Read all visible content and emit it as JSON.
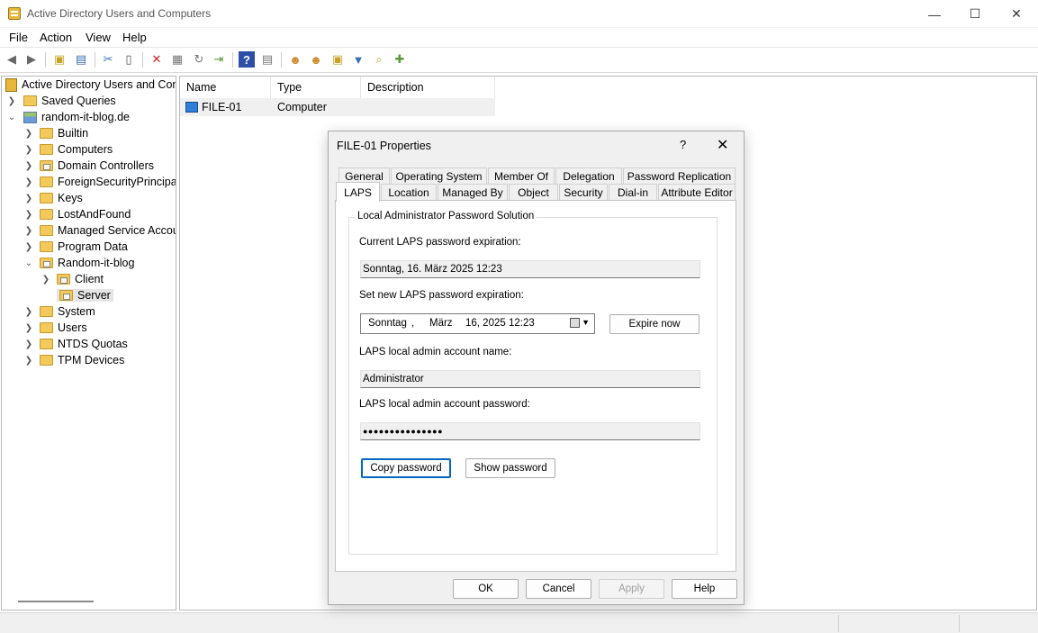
{
  "window": {
    "title": "Active Directory Users and Computers"
  },
  "menu": [
    "File",
    "Action",
    "View",
    "Help"
  ],
  "tree": {
    "root": "Active Directory Users and Com",
    "saved_queries": "Saved Queries",
    "domain": "random-it-blog.de",
    "items": [
      "Builtin",
      "Computers",
      "Domain Controllers",
      "ForeignSecurityPrincipals",
      "Keys",
      "LostAndFound",
      "Managed Service Accour",
      "Program Data",
      "Random-it-blog",
      "Client",
      "Server",
      "System",
      "Users",
      "NTDS Quotas",
      "TPM Devices"
    ]
  },
  "list": {
    "columns": [
      "Name",
      "Type",
      "Description"
    ],
    "rows": [
      {
        "name": "FILE-01",
        "type": "Computer",
        "description": ""
      }
    ]
  },
  "dialog": {
    "title": "FILE-01 Properties",
    "help_glyph": "?",
    "tabs_row1": [
      "General",
      "Operating System",
      "Member Of",
      "Delegation",
      "Password Replication"
    ],
    "tabs_row2": [
      "LAPS",
      "Location",
      "Managed By",
      "Object",
      "Security",
      "Dial-in",
      "Attribute Editor"
    ],
    "group_title": "Local Administrator Password Solution",
    "current_exp_label": "Current LAPS password expiration:",
    "current_exp_value": "Sonntag, 16. März 2025 12:23",
    "new_exp_label": "Set new LAPS password expiration:",
    "date_day": "Sonntag",
    "date_sep": ",",
    "date_month": "März",
    "date_rest": "16, 2025 12:23",
    "expire_now": "Expire now",
    "account_label": "LAPS local admin account name:",
    "account_value": "Administrator",
    "password_label": "LAPS local admin account password:",
    "password_value": "●●●●●●●●●●●●●●●",
    "copy_password": "Copy password",
    "show_password": "Show password",
    "ok": "OK",
    "cancel": "Cancel",
    "apply": "Apply",
    "help": "Help"
  }
}
